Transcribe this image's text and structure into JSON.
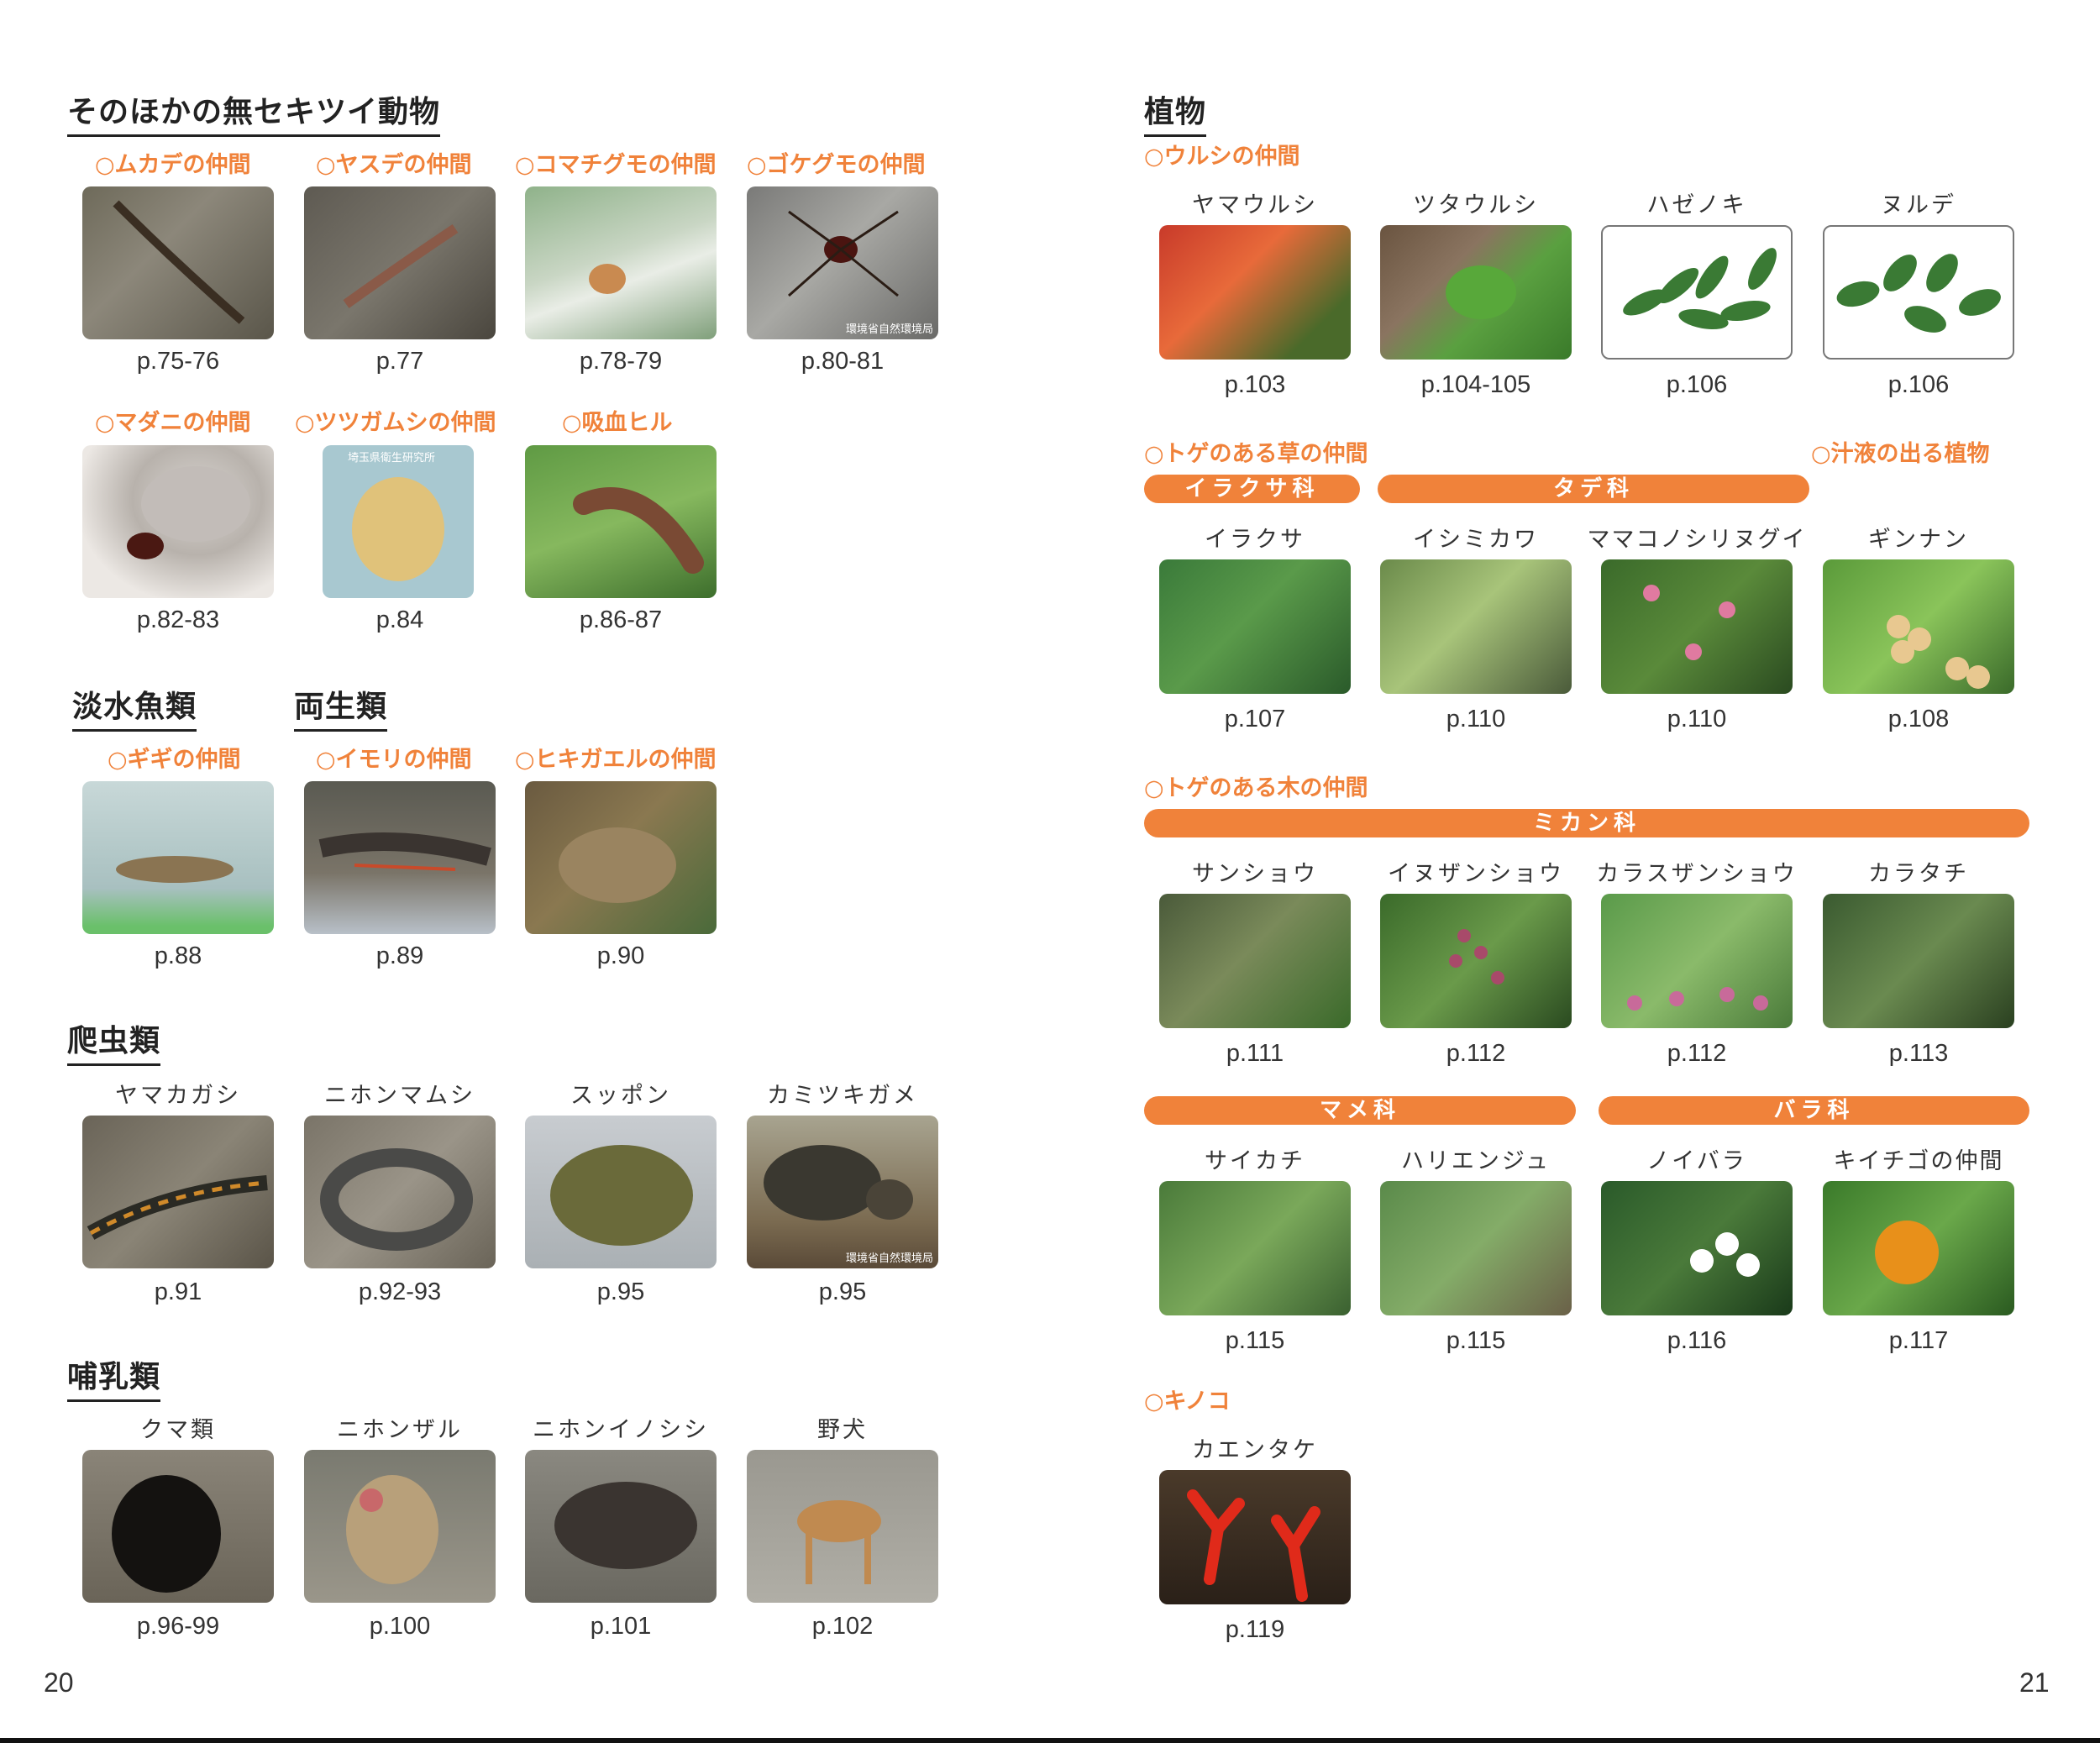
{
  "left": {
    "section1": {
      "title": "そのほかの無セキツイ動物",
      "groups": [
        {
          "label": "○ムカデの仲間",
          "page": "p.75-76"
        },
        {
          "label": "○ヤスデの仲間",
          "page": "p.77"
        },
        {
          "label": "○コマチグモの仲間",
          "page": "p.78-79"
        },
        {
          "label": "○ゴケグモの仲間",
          "page": "p.80-81",
          "credit": "環境省自然環境局"
        },
        {
          "label": "○マダニの仲間",
          "page": "p.82-83"
        },
        {
          "label": "○ツツガムシの仲間",
          "page": "p.84",
          "credit": "埼玉県衛生研究所"
        },
        {
          "label": "○吸血ヒル",
          "page": "p.86-87"
        }
      ]
    },
    "section2": {
      "title": "淡水魚類"
    },
    "section3": {
      "title": "両生類"
    },
    "fishAmph": [
      {
        "label": "○ギギの仲間",
        "page": "p.88"
      },
      {
        "label": "○イモリの仲間",
        "page": "p.89"
      },
      {
        "label": "○ヒキガエルの仲間",
        "page": "p.90"
      }
    ],
    "section4": {
      "title": "爬虫類",
      "items": [
        {
          "name": "ヤマカガシ",
          "page": "p.91"
        },
        {
          "name": "ニホンマムシ",
          "page": "p.92-93"
        },
        {
          "name": "スッポン",
          "page": "p.95"
        },
        {
          "name": "カミツキガメ",
          "page": "p.95",
          "credit": "環境省自然環境局"
        }
      ]
    },
    "section5": {
      "title": "哺乳類",
      "items": [
        {
          "name": "クマ類",
          "page": "p.96-99"
        },
        {
          "name": "ニホンザル",
          "page": "p.100"
        },
        {
          "name": "ニホンイノシシ",
          "page": "p.101"
        },
        {
          "name": "野犬",
          "page": "p.102"
        }
      ]
    },
    "page_number": "20"
  },
  "right": {
    "title": "植物",
    "urushi": {
      "label": "○ウルシの仲間",
      "items": [
        {
          "name": "ヤマウルシ",
          "page": "p.103"
        },
        {
          "name": "ツタウルシ",
          "page": "p.104-105"
        },
        {
          "name": "ハゼノキ",
          "page": "p.106"
        },
        {
          "name": "ヌルデ",
          "page": "p.106"
        }
      ]
    },
    "toge_kusa": {
      "label": "○トゲのある草の仲間"
    },
    "juueki": {
      "label": "○汁液の出る植物"
    },
    "bar_irakusa": "イラクサ科",
    "bar_tade": "タデ科",
    "row2": [
      {
        "name": "イラクサ",
        "page": "p.107"
      },
      {
        "name": "イシミカワ",
        "page": "p.110"
      },
      {
        "name": "ママコノシリヌグイ",
        "page": "p.110"
      },
      {
        "name": "ギンナン",
        "page": "p.108"
      }
    ],
    "toge_ki": {
      "label": "○トゲのある木の仲間"
    },
    "bar_mikan": "ミカン科",
    "row3": [
      {
        "name": "サンショウ",
        "page": "p.111"
      },
      {
        "name": "イヌザンショウ",
        "page": "p.112"
      },
      {
        "name": "カラスザンショウ",
        "page": "p.112"
      },
      {
        "name": "カラタチ",
        "page": "p.113"
      }
    ],
    "bar_mame": "マメ科",
    "bar_bara": "バラ科",
    "row4": [
      {
        "name": "サイカチ",
        "page": "p.115"
      },
      {
        "name": "ハリエンジュ",
        "page": "p.115"
      },
      {
        "name": "ノイバラ",
        "page": "p.116"
      },
      {
        "name": "キイチゴの仲間",
        "page": "p.117"
      }
    ],
    "kinoko": {
      "label": "○キノコ",
      "items": [
        {
          "name": "カエンタケ",
          "page": "p.119"
        }
      ]
    },
    "page_number": "21"
  }
}
